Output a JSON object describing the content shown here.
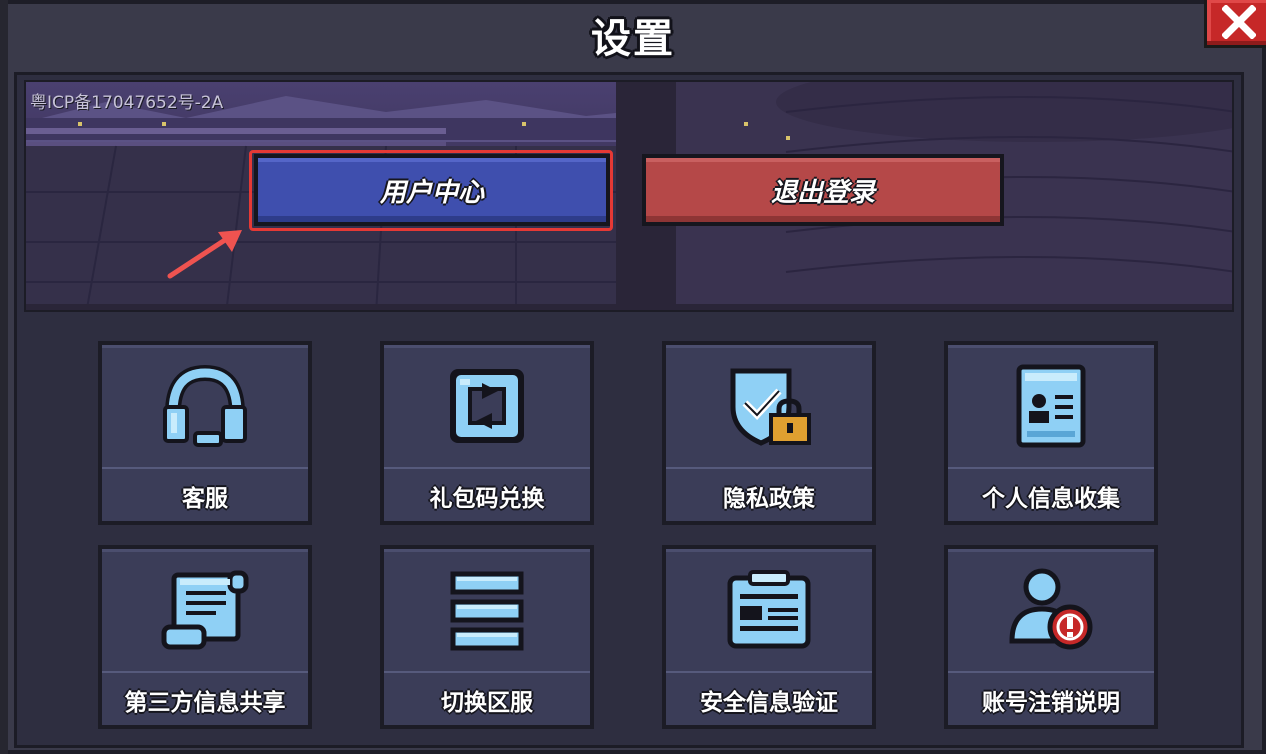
{
  "window": {
    "title": "设置",
    "close_icon": "close-icon"
  },
  "banner": {
    "icp": "粤ICP备17047652号-2A",
    "user_center_label": "用户中心",
    "logout_label": "退出登录"
  },
  "tiles": [
    {
      "label": "客服",
      "icon": "headset-icon"
    },
    {
      "label": "礼包码兑换",
      "icon": "exchange-icon"
    },
    {
      "label": "隐私政策",
      "icon": "shield-lock-icon"
    },
    {
      "label": "个人信息收集",
      "icon": "id-card-icon"
    },
    {
      "label": "第三方信息共享",
      "icon": "scroll-icon"
    },
    {
      "label": "切换区服",
      "icon": "server-list-icon"
    },
    {
      "label": "安全信息验证",
      "icon": "clipboard-icon"
    },
    {
      "label": "账号注销说明",
      "icon": "user-warning-icon"
    }
  ],
  "colors": {
    "accent_blue": "#3f4fae",
    "accent_red": "#b54848",
    "icon_blue": "#8fd0f5",
    "highlight_outline": "#e53935"
  }
}
